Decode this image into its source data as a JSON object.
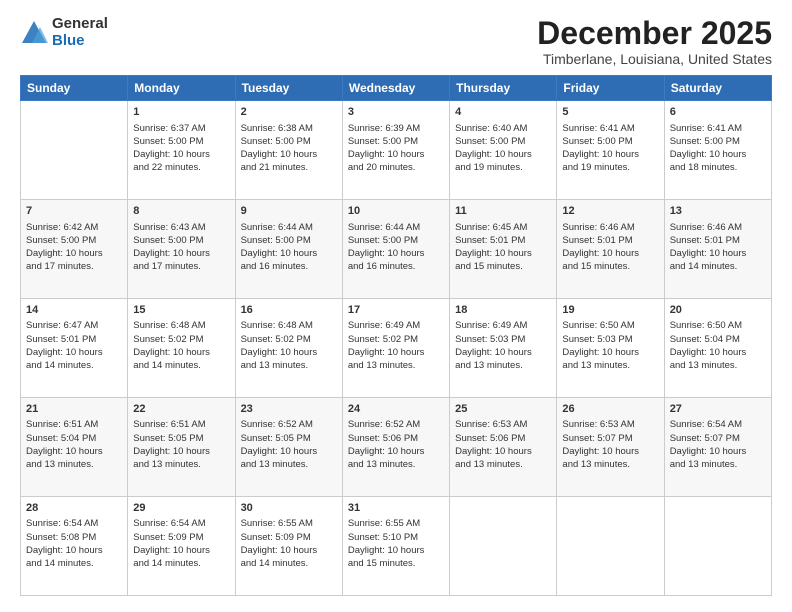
{
  "logo": {
    "general": "General",
    "blue": "Blue"
  },
  "header": {
    "title": "December 2025",
    "subtitle": "Timberlane, Louisiana, United States"
  },
  "calendar": {
    "days_of_week": [
      "Sunday",
      "Monday",
      "Tuesday",
      "Wednesday",
      "Thursday",
      "Friday",
      "Saturday"
    ],
    "weeks": [
      [
        {
          "day": "",
          "info": ""
        },
        {
          "day": "1",
          "info": "Sunrise: 6:37 AM\nSunset: 5:00 PM\nDaylight: 10 hours\nand 22 minutes."
        },
        {
          "day": "2",
          "info": "Sunrise: 6:38 AM\nSunset: 5:00 PM\nDaylight: 10 hours\nand 21 minutes."
        },
        {
          "day": "3",
          "info": "Sunrise: 6:39 AM\nSunset: 5:00 PM\nDaylight: 10 hours\nand 20 minutes."
        },
        {
          "day": "4",
          "info": "Sunrise: 6:40 AM\nSunset: 5:00 PM\nDaylight: 10 hours\nand 19 minutes."
        },
        {
          "day": "5",
          "info": "Sunrise: 6:41 AM\nSunset: 5:00 PM\nDaylight: 10 hours\nand 19 minutes."
        },
        {
          "day": "6",
          "info": "Sunrise: 6:41 AM\nSunset: 5:00 PM\nDaylight: 10 hours\nand 18 minutes."
        }
      ],
      [
        {
          "day": "7",
          "info": "Sunrise: 6:42 AM\nSunset: 5:00 PM\nDaylight: 10 hours\nand 17 minutes."
        },
        {
          "day": "8",
          "info": "Sunrise: 6:43 AM\nSunset: 5:00 PM\nDaylight: 10 hours\nand 17 minutes."
        },
        {
          "day": "9",
          "info": "Sunrise: 6:44 AM\nSunset: 5:00 PM\nDaylight: 10 hours\nand 16 minutes."
        },
        {
          "day": "10",
          "info": "Sunrise: 6:44 AM\nSunset: 5:00 PM\nDaylight: 10 hours\nand 16 minutes."
        },
        {
          "day": "11",
          "info": "Sunrise: 6:45 AM\nSunset: 5:01 PM\nDaylight: 10 hours\nand 15 minutes."
        },
        {
          "day": "12",
          "info": "Sunrise: 6:46 AM\nSunset: 5:01 PM\nDaylight: 10 hours\nand 15 minutes."
        },
        {
          "day": "13",
          "info": "Sunrise: 6:46 AM\nSunset: 5:01 PM\nDaylight: 10 hours\nand 14 minutes."
        }
      ],
      [
        {
          "day": "14",
          "info": "Sunrise: 6:47 AM\nSunset: 5:01 PM\nDaylight: 10 hours\nand 14 minutes."
        },
        {
          "day": "15",
          "info": "Sunrise: 6:48 AM\nSunset: 5:02 PM\nDaylight: 10 hours\nand 14 minutes."
        },
        {
          "day": "16",
          "info": "Sunrise: 6:48 AM\nSunset: 5:02 PM\nDaylight: 10 hours\nand 13 minutes."
        },
        {
          "day": "17",
          "info": "Sunrise: 6:49 AM\nSunset: 5:02 PM\nDaylight: 10 hours\nand 13 minutes."
        },
        {
          "day": "18",
          "info": "Sunrise: 6:49 AM\nSunset: 5:03 PM\nDaylight: 10 hours\nand 13 minutes."
        },
        {
          "day": "19",
          "info": "Sunrise: 6:50 AM\nSunset: 5:03 PM\nDaylight: 10 hours\nand 13 minutes."
        },
        {
          "day": "20",
          "info": "Sunrise: 6:50 AM\nSunset: 5:04 PM\nDaylight: 10 hours\nand 13 minutes."
        }
      ],
      [
        {
          "day": "21",
          "info": "Sunrise: 6:51 AM\nSunset: 5:04 PM\nDaylight: 10 hours\nand 13 minutes."
        },
        {
          "day": "22",
          "info": "Sunrise: 6:51 AM\nSunset: 5:05 PM\nDaylight: 10 hours\nand 13 minutes."
        },
        {
          "day": "23",
          "info": "Sunrise: 6:52 AM\nSunset: 5:05 PM\nDaylight: 10 hours\nand 13 minutes."
        },
        {
          "day": "24",
          "info": "Sunrise: 6:52 AM\nSunset: 5:06 PM\nDaylight: 10 hours\nand 13 minutes."
        },
        {
          "day": "25",
          "info": "Sunrise: 6:53 AM\nSunset: 5:06 PM\nDaylight: 10 hours\nand 13 minutes."
        },
        {
          "day": "26",
          "info": "Sunrise: 6:53 AM\nSunset: 5:07 PM\nDaylight: 10 hours\nand 13 minutes."
        },
        {
          "day": "27",
          "info": "Sunrise: 6:54 AM\nSunset: 5:07 PM\nDaylight: 10 hours\nand 13 minutes."
        }
      ],
      [
        {
          "day": "28",
          "info": "Sunrise: 6:54 AM\nSunset: 5:08 PM\nDaylight: 10 hours\nand 14 minutes."
        },
        {
          "day": "29",
          "info": "Sunrise: 6:54 AM\nSunset: 5:09 PM\nDaylight: 10 hours\nand 14 minutes."
        },
        {
          "day": "30",
          "info": "Sunrise: 6:55 AM\nSunset: 5:09 PM\nDaylight: 10 hours\nand 14 minutes."
        },
        {
          "day": "31",
          "info": "Sunrise: 6:55 AM\nSunset: 5:10 PM\nDaylight: 10 hours\nand 15 minutes."
        },
        {
          "day": "",
          "info": ""
        },
        {
          "day": "",
          "info": ""
        },
        {
          "day": "",
          "info": ""
        }
      ]
    ]
  }
}
